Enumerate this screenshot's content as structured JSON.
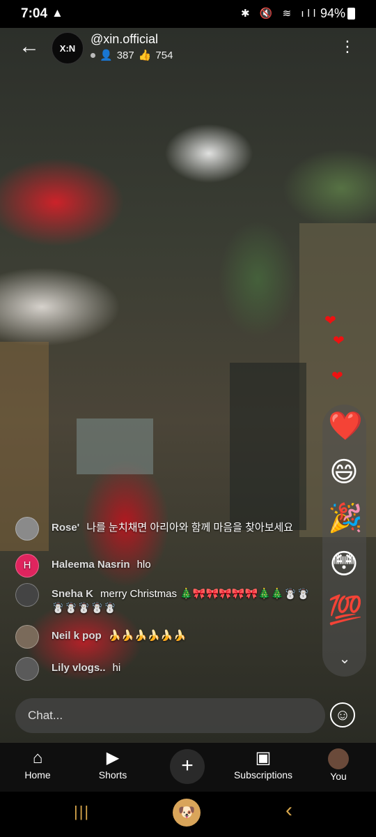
{
  "status_bar": {
    "time": "7:04",
    "warning": "▲",
    "icons": "✱ 🔇 ≋ ıll",
    "battery": "94%"
  },
  "header": {
    "logo_text": "X:N",
    "channel": "@xin.official",
    "viewers": "387",
    "likes": "754",
    "back_icon": "arrow-left-icon",
    "more_icon": "vertical-dots-icon"
  },
  "reactions": [
    {
      "name": "red-heart-icon",
      "glyph": "❤️"
    },
    {
      "name": "grinning-face-icon",
      "glyph": "😄"
    },
    {
      "name": "party-popper-icon",
      "glyph": "🎉"
    },
    {
      "name": "flushed-face-icon",
      "glyph": "😳"
    },
    {
      "name": "hundred-points-icon",
      "glyph": "💯"
    }
  ],
  "chat": {
    "messages": [
      {
        "author": "Rose'",
        "initial": "",
        "avatar_color": "#8a8a8a",
        "text": "나를 눈치채면 아리아와 함께 마음을 찾아보세요"
      },
      {
        "author": "Haleema Nasrin",
        "initial": "H",
        "avatar_color": "#e0245e",
        "text": "hlo"
      },
      {
        "author": "Sneha K",
        "initial": "",
        "avatar_color": "#444",
        "text": "merry Christmas 🎄🎀🎀🎀🎀🎀🎄🎄☃️☃️☃️☃️☃️☃️☃️"
      },
      {
        "author": "Neil k pop",
        "initial": "",
        "avatar_color": "#7a6a5a",
        "text": "🍌🍌🍌🍌🍌🍌"
      },
      {
        "author": "Lily vlogs..",
        "initial": "",
        "avatar_color": "#5a5a5a",
        "text": "hi"
      }
    ],
    "input_placeholder": "Chat...",
    "emoji_icon": "☺"
  },
  "nav": {
    "home": "Home",
    "shorts": "Shorts",
    "subscriptions": "Subscriptions",
    "you": "You"
  },
  "colors": {
    "accent_red": "#e11d2a",
    "nav_bg": "#0f0f0f"
  }
}
